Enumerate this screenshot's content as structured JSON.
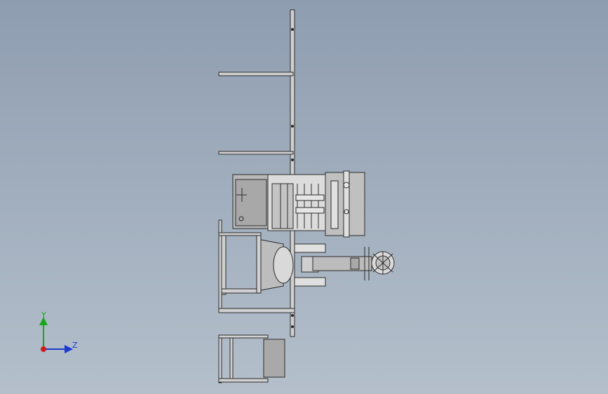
{
  "viewport": {
    "background_top": "#8e9db0",
    "background_bottom": "#b4bfcb"
  },
  "model": {
    "line_color": "#2b2b2b",
    "fill_color": "#c9c9c9",
    "shadow_color": "#8a8a8a"
  },
  "triad": {
    "y_label": "Y",
    "z_label": "Z",
    "y_color": "#17a81a",
    "z_color": "#1b3ad1",
    "origin_color": "#d11b1b"
  }
}
